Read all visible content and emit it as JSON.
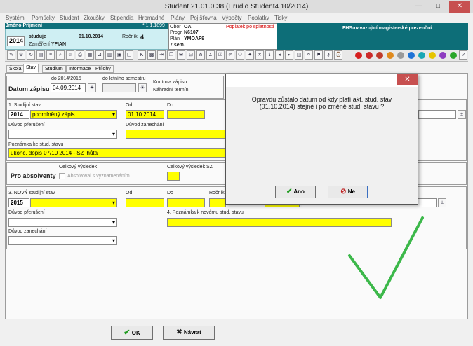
{
  "window": {
    "title": "Student   21.01.0.38   (Erudio Student4 10/2014)",
    "minimize": "—",
    "maximize": "□",
    "close": "✕"
  },
  "menu": [
    "Systém",
    "Pomůcky",
    "Student",
    "Zkoušky",
    "Stipendia",
    "Hromadné",
    "Plány",
    "Pojišťovna",
    "Výpočty",
    "Poplatky",
    "Tisky"
  ],
  "header": {
    "name_label": "Jméno Příjmení",
    "birth": "* 1.1.1899",
    "year": "2014",
    "status": "studuje",
    "date": "01.10.2014",
    "rocnik_label": "Ročník",
    "rocnik": "4",
    "zamereni_label": "Zaměření",
    "zamereni": "YFIAN",
    "obor_label": "Obor",
    "obor": "OA",
    "progr_label": "Progr.",
    "progr": "N6107",
    "plan_label": "Plán",
    "plan": "YMOAF9",
    "semester": "7.sem.",
    "poplatek": "Poplatek po splatnosti",
    "faculty": "FHS-navazující magisterské prezenční"
  },
  "tabs": [
    "Škola",
    "Stav",
    "Studium",
    "Informace",
    "Přílohy"
  ],
  "form": {
    "zapis_year_label": "do 2014/2015",
    "letni_label": "do letního semestru",
    "datum_zapisu_label": "Datum zápisu",
    "datum_zapisu": "04.09.2014",
    "kontrola_label": "Kontrola zápisu",
    "nahradni_label": "Náhradní termín",
    "studijni_stav_label": "1. Studijní stav",
    "stav_year": "2014",
    "stav_value": "podmíněný zápis",
    "od_label": "Od",
    "od_value": "01.10.2014",
    "do_label": "Do",
    "duvod_preruseni_label": "Důvod přerušení",
    "duvod_zanechani_label": "Důvod zanechání",
    "poznamka_label": "Poznámka ke stud. stavu",
    "poznamka_value": "ukonc. dopis 07/10 2014 - SZ lhůta",
    "absolventy_label": "Pro absolventy",
    "celkovy_label": "Celkový výsledek",
    "absolvoval_label": "Absolvoval s vyznamenáním",
    "celkovy_sz_label": "Celkový výsledek SZ",
    "novy_stav_label": "3. NOVÝ studijní stav",
    "novy_year": "2015",
    "novy_od_label": "Od",
    "novy_do_label": "Do",
    "rocnik_label": "Ročník",
    "novy_duvod_preruseni_label": "Důvod přerušení",
    "novy_poznamka_label": "4. Poznámka k novému stud. stavu",
    "novy_duvod_zanechani_label": "Důvod zanechání"
  },
  "dialog": {
    "message_line1": "Opravdu zůstalo datum od kdy platí akt. stud. stav",
    "message_line2": "(01.10.2014) stejné i po změně stud. stavu ?",
    "yes_label": "Ano",
    "no_label": "Ne"
  },
  "footer": {
    "ok_label": "OK",
    "back_label": "Návrat"
  },
  "colors": {
    "highlight": "#ffff00",
    "header_teal": "#0d6e78",
    "check_green": "#3cb84a",
    "poplatek_red": "#d40000"
  }
}
